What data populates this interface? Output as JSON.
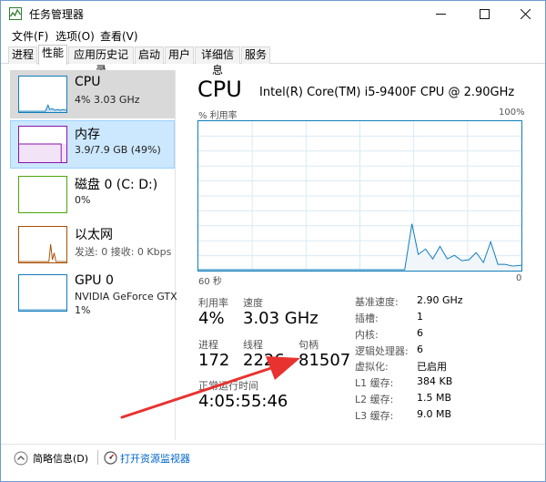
{
  "window": {
    "title": "任务管理器"
  },
  "menu": [
    "文件(F)",
    "选项(O)",
    "查看(V)"
  ],
  "tabs": [
    "进程",
    "性能",
    "应用历史记录",
    "启动",
    "用户",
    "详细信息",
    "服务"
  ],
  "active_tab": "性能",
  "sidebar": [
    {
      "title": "CPU",
      "sub": "4% 3.03 GHz",
      "color": "#117dbb"
    },
    {
      "title": "内存",
      "sub": "3.9/7.9 GB (49%)",
      "color": "#8b12ae"
    },
    {
      "title": "磁盘 0 (C: D:)",
      "sub": "0%",
      "color": "#4da60c"
    },
    {
      "title": "以太网",
      "sub": "发送: 0 接收: 0 Kbps",
      "color": "#a74f01"
    },
    {
      "title": "GPU 0",
      "sub": "NVIDIA GeForce GTX",
      "sub2": "1%",
      "color": "#117dbb"
    }
  ],
  "main": {
    "title": "CPU",
    "model": "Intel(R) Core(TM) i5-9400F CPU @ 2.90GHz",
    "graph_label_tl": "% 利用率",
    "graph_label_tr": "100%",
    "graph_label_bl": "60 秒",
    "graph_label_br": "0",
    "utilization_label": "利用率",
    "utilization": "4%",
    "speed_label": "速度",
    "speed": "3.03 GHz",
    "processes_label": "进程",
    "processes": "172",
    "threads_label": "线程",
    "threads": "2226",
    "handles_label": "句柄",
    "handles": "81507",
    "uptime_label": "正常运行时间",
    "uptime": "4:05:55:46",
    "details": [
      {
        "k": "基准速度:",
        "v": "2.90 GHz"
      },
      {
        "k": "插槽:",
        "v": "1"
      },
      {
        "k": "内核:",
        "v": "6"
      },
      {
        "k": "逻辑处理器:",
        "v": "6"
      },
      {
        "k": "虚拟化:",
        "v": "已启用"
      },
      {
        "k": "L1 缓存:",
        "v": "384 KB"
      },
      {
        "k": "L2 缓存:",
        "v": "1.5 MB"
      },
      {
        "k": "L3 缓存:",
        "v": "9.0 MB"
      }
    ]
  },
  "footer": {
    "fewer_details": "简略信息(D)",
    "resource_monitor": "打开资源监视器"
  },
  "colors": {
    "cpu_line": "#117dbb",
    "cpu_fill": "#f1f6fa",
    "arrow": "#e8322f",
    "link": "#0066cc"
  }
}
